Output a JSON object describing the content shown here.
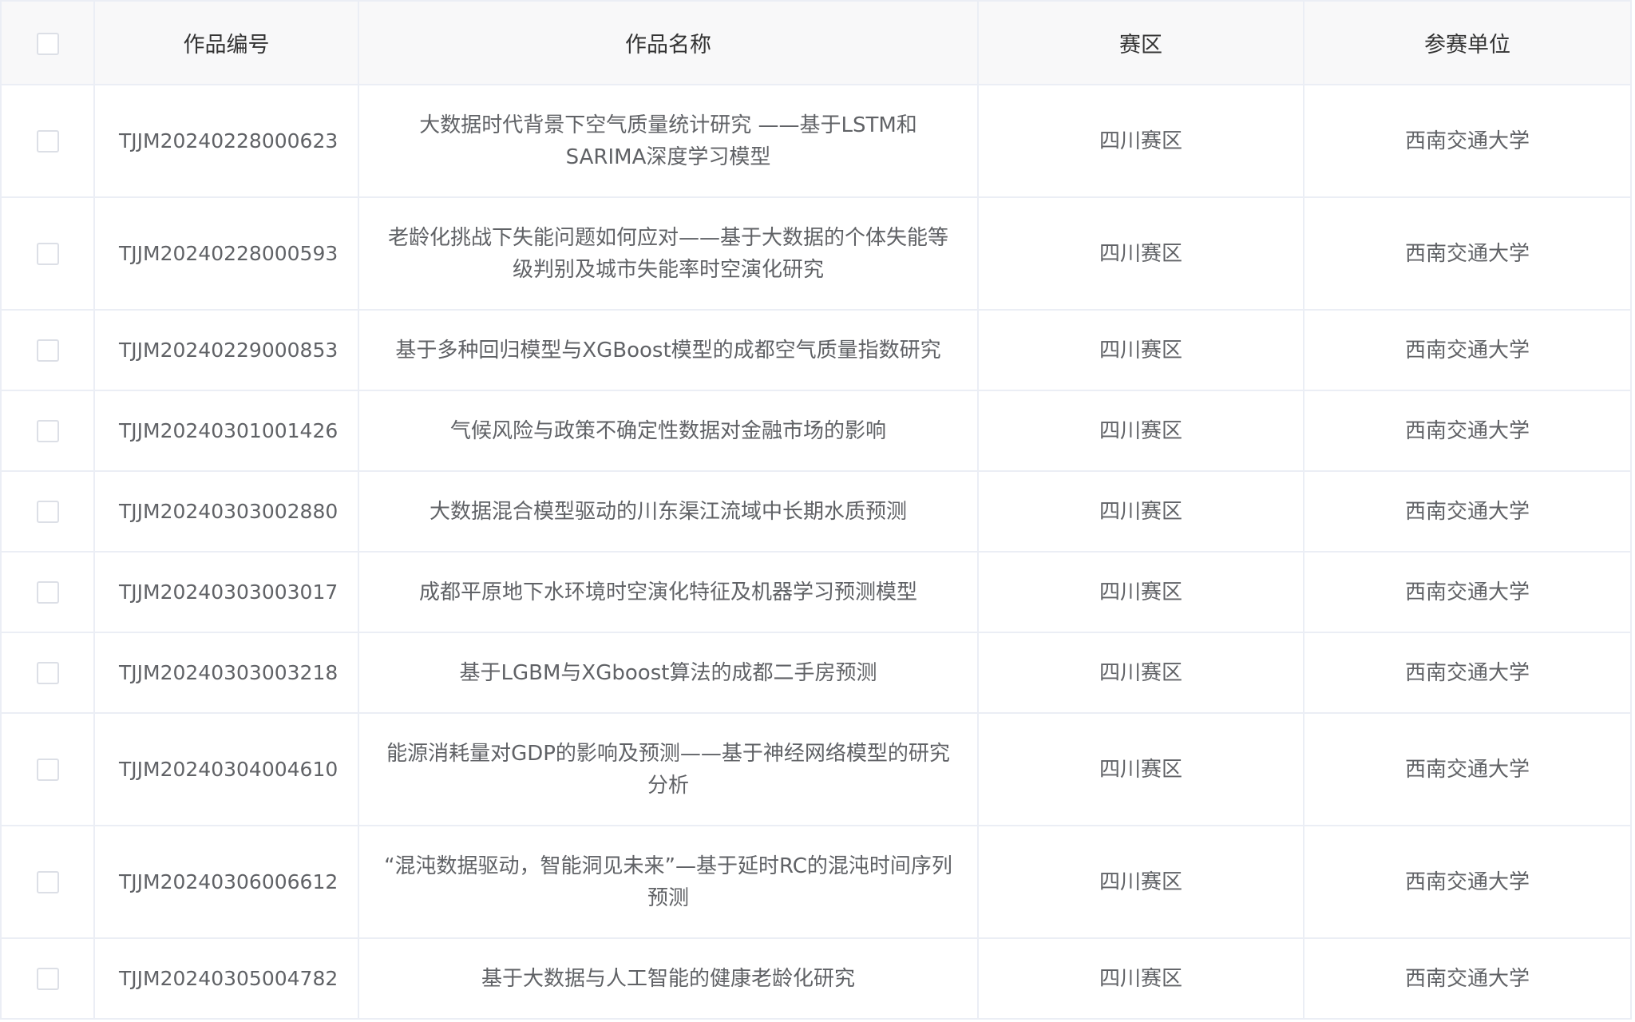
{
  "table": {
    "columns": {
      "id": "作品编号",
      "name": "作品名称",
      "region": "赛区",
      "unit": "参赛单位"
    },
    "rows": [
      {
        "id": "TJJM20240228000623",
        "name": "大数据时代背景下空气质量统计研究 ——基于LSTM和SARIMA深度学习模型",
        "region": "四川赛区",
        "unit": "西南交通大学"
      },
      {
        "id": "TJJM20240228000593",
        "name": "老龄化挑战下失能问题如何应对——基于大数据的个体失能等级判别及城市失能率时空演化研究",
        "region": "四川赛区",
        "unit": "西南交通大学"
      },
      {
        "id": "TJJM20240229000853",
        "name": "基于多种回归模型与XGBoost模型的成都空气质量指数研究",
        "region": "四川赛区",
        "unit": "西南交通大学"
      },
      {
        "id": "TJJM20240301001426",
        "name": "气候风险与政策不确定性数据对金融市场的影响",
        "region": "四川赛区",
        "unit": "西南交通大学"
      },
      {
        "id": "TJJM20240303002880",
        "name": "大数据混合模型驱动的川东渠江流域中长期水质预测",
        "region": "四川赛区",
        "unit": "西南交通大学"
      },
      {
        "id": "TJJM20240303003017",
        "name": "成都平原地下水环境时空演化特征及机器学习预测模型",
        "region": "四川赛区",
        "unit": "西南交通大学"
      },
      {
        "id": "TJJM20240303003218",
        "name": "基于LGBM与XGboost算法的成都二手房预测",
        "region": "四川赛区",
        "unit": "西南交通大学"
      },
      {
        "id": "TJJM20240304004610",
        "name": "能源消耗量对GDP的影响及预测——基于神经网络模型的研究分析",
        "region": "四川赛区",
        "unit": "西南交通大学"
      },
      {
        "id": "TJJM20240306006612",
        "name": "“混沌数据驱动，智能洞见未来”—基于延时RC的混沌时间序列预测",
        "region": "四川赛区",
        "unit": "西南交通大学"
      },
      {
        "id": "TJJM20240305004782",
        "name": "基于大数据与人工智能的健康老龄化研究",
        "region": "四川赛区",
        "unit": "西南交通大学"
      }
    ]
  }
}
